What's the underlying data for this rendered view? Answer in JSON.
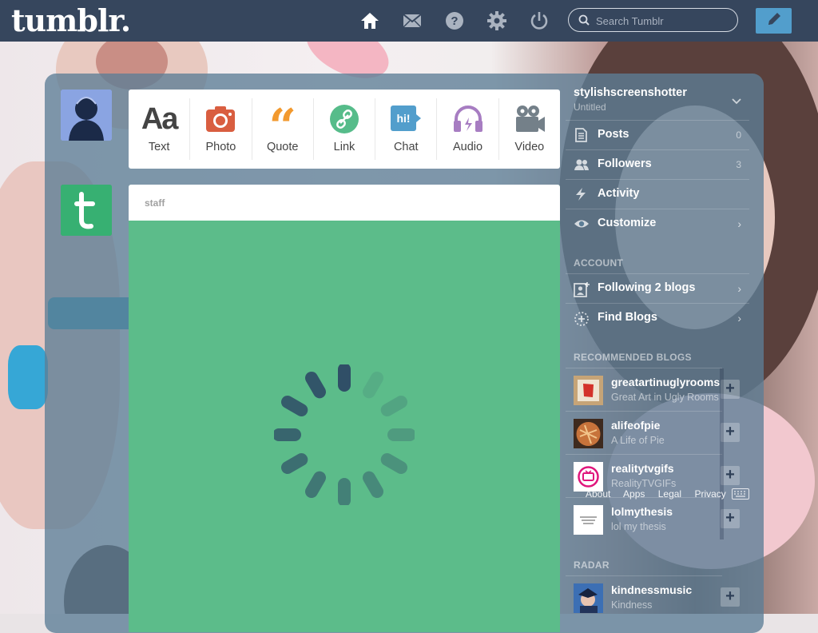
{
  "header": {
    "logo": "tumblr.",
    "search_placeholder": "Search Tumblr",
    "icons": [
      "home-icon",
      "mail-icon",
      "help-icon",
      "gear-icon",
      "power-icon"
    ],
    "compose_icon": "pencil-icon"
  },
  "post_types": [
    {
      "label": "Text",
      "icon": "text-icon",
      "color": "#444444"
    },
    {
      "label": "Photo",
      "icon": "camera-icon",
      "color": "#d95e40"
    },
    {
      "label": "Quote",
      "icon": "quote-icon",
      "color": "#f2992e"
    },
    {
      "label": "Link",
      "icon": "link-icon",
      "color": "#56bc8a"
    },
    {
      "label": "Chat",
      "icon": "chat-icon",
      "color": "#529ecc"
    },
    {
      "label": "Audio",
      "icon": "headphones-icon",
      "color": "#a77dc2"
    },
    {
      "label": "Video",
      "icon": "video-camera-icon",
      "color": "#748089"
    }
  ],
  "post": {
    "username": "staff",
    "background": "#5cbc8a"
  },
  "sidebar": {
    "blog_name": "stylishscreenshotter",
    "blog_title": "Untitled",
    "items": [
      {
        "label": "Posts",
        "count": "0",
        "icon": "posts-icon"
      },
      {
        "label": "Followers",
        "count": "3",
        "icon": "followers-icon"
      },
      {
        "label": "Activity",
        "icon": "lightning-icon"
      },
      {
        "label": "Customize",
        "icon": "eye-icon"
      }
    ],
    "account_heading": "ACCOUNT",
    "account_items": [
      {
        "label": "Following 2 blogs",
        "icon": "following-icon"
      },
      {
        "label": "Find Blogs",
        "icon": "find-blogs-icon"
      }
    ],
    "recommended_heading": "RECOMMENDED BLOGS",
    "recommended": [
      {
        "name": "greatartinuglyrooms",
        "desc": "Great Art in Ugly Rooms"
      },
      {
        "name": "alifeofpie",
        "desc": "A Life of Pie"
      },
      {
        "name": "realitytvgifs",
        "desc": "RealityTVGIFs"
      },
      {
        "name": "lolmythesis",
        "desc": "lol my thesis"
      }
    ],
    "footer_links": [
      "About",
      "Apps",
      "Legal",
      "Privacy"
    ],
    "radar_heading": "RADAR",
    "radar": {
      "name": "kindnessmusic",
      "desc": "Kindness"
    }
  }
}
